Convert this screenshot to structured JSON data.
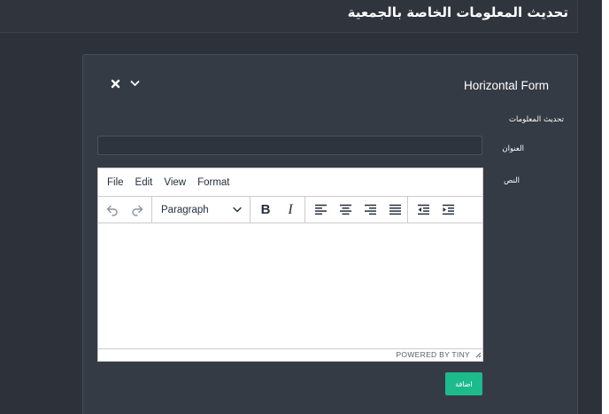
{
  "header": {
    "title": "تحديث المعلومات الخاصة بالجمعية"
  },
  "card": {
    "title": "Horizontal Form",
    "tools": {
      "close_icon": "close-icon",
      "collapse_icon": "chevron-down-icon"
    }
  },
  "form": {
    "heading": "تحديث المعلومات",
    "title_label": "العنوان",
    "title_value": "",
    "text_label": "النص",
    "submit_label": "اضافة"
  },
  "editor": {
    "menu": [
      "File",
      "Edit",
      "View",
      "Format"
    ],
    "block_format": "Paragraph",
    "toolbar_icons": [
      "undo-icon",
      "redo-icon",
      "bold-icon",
      "italic-icon",
      "align-left-icon",
      "align-center-icon",
      "align-right-icon",
      "align-justify-icon",
      "outdent-icon",
      "indent-icon"
    ],
    "branding": "POWERED BY TINY"
  },
  "colors": {
    "background": "#2d323a",
    "card": "#353b44",
    "accent": "#1dbb8b",
    "editor_text": "#222f3e"
  }
}
